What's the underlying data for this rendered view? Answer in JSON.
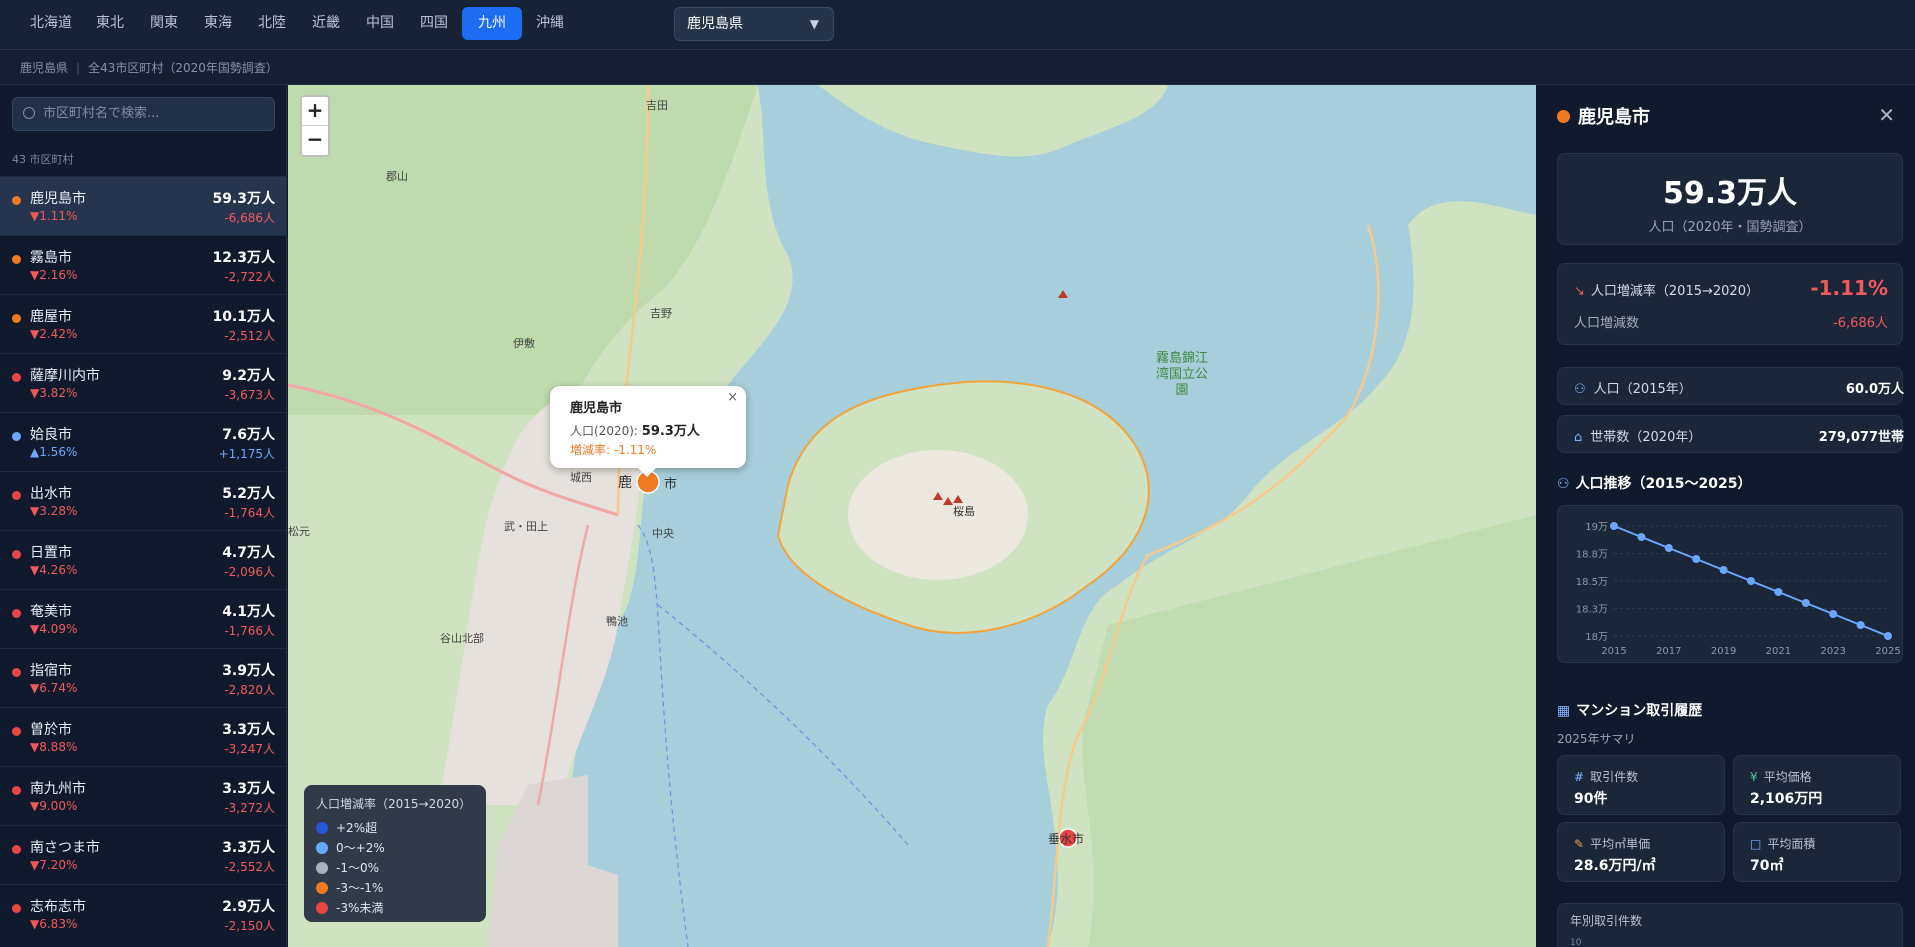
{
  "regions": [
    "北海道",
    "東北",
    "関東",
    "東海",
    "北陸",
    "近畿",
    "中国",
    "四国",
    "九州",
    "沖縄"
  ],
  "active_region": "九州",
  "prefecture_select": "鹿児島県",
  "subbar": {
    "prefecture": "鹿児島県",
    "summary": "全43市区町村（2020年国勢調査）"
  },
  "search": {
    "placeholder": "市区町村名で検索..."
  },
  "list_count": "43 市区町村",
  "municipalities": [
    {
      "name": "鹿児島市",
      "rate": "▼1.11%",
      "pop": "59.3万人",
      "diff": "-6,686人",
      "color": "#f07a24"
    },
    {
      "name": "霧島市",
      "rate": "▼2.16%",
      "pop": "12.3万人",
      "diff": "-2,722人",
      "color": "#f07a24"
    },
    {
      "name": "鹿屋市",
      "rate": "▼2.42%",
      "pop": "10.1万人",
      "diff": "-2,512人",
      "color": "#f07a24"
    },
    {
      "name": "薩摩川内市",
      "rate": "▼3.82%",
      "pop": "9.2万人",
      "diff": "-3,673人",
      "color": "#e84545"
    },
    {
      "name": "姶良市",
      "rate": "▲1.56%",
      "pop": "7.6万人",
      "diff": "+1,175人",
      "color": "#6aa7ff"
    },
    {
      "name": "出水市",
      "rate": "▼3.28%",
      "pop": "5.2万人",
      "diff": "-1,764人",
      "color": "#e84545"
    },
    {
      "name": "日置市",
      "rate": "▼4.26%",
      "pop": "4.7万人",
      "diff": "-2,096人",
      "color": "#e84545"
    },
    {
      "name": "奄美市",
      "rate": "▼4.09%",
      "pop": "4.1万人",
      "diff": "-1,766人",
      "color": "#e84545"
    },
    {
      "name": "指宿市",
      "rate": "▼6.74%",
      "pop": "3.9万人",
      "diff": "-2,820人",
      "color": "#e84545"
    },
    {
      "name": "曽於市",
      "rate": "▼8.88%",
      "pop": "3.3万人",
      "diff": "-3,247人",
      "color": "#e84545"
    },
    {
      "name": "南九州市",
      "rate": "▼9.00%",
      "pop": "3.3万人",
      "diff": "-3,272人",
      "color": "#e84545"
    },
    {
      "name": "南さつま市",
      "rate": "▼7.20%",
      "pop": "3.3万人",
      "diff": "-2,552人",
      "color": "#e84545"
    },
    {
      "name": "志布志市",
      "rate": "▼6.83%",
      "pop": "2.9万人",
      "diff": "-2,150人",
      "color": "#e84545"
    }
  ],
  "map": {
    "zoom_in": "+",
    "zoom_out": "−",
    "labels": {
      "sakurajima": "桜島",
      "park": "霧島錦江湾国立公園",
      "tarumizu": "垂水市",
      "kagoshima": "鹿",
      "shi": "市",
      "ijuin": "伊敷",
      "yoshino": "吉野",
      "chuo": "中央",
      "taniyama": "谷山北部",
      "kamoike": "鴨池",
      "shiroyama": "城西",
      "takeda": "武・田上",
      "matsumoto": "松元",
      "gunsan": "郡山",
      "kiire": "吉田"
    },
    "popup": {
      "title": "鹿児島市",
      "pop_label": "人口(2020):",
      "pop_value": "59.3万人",
      "rate": "増減率: -1.11%",
      "close": "×"
    },
    "legend": {
      "title": "人口増減率（2015→2020）",
      "items": [
        {
          "label": "+2%超",
          "color": "#2357d6"
        },
        {
          "label": "0〜+2%",
          "color": "#6aa7ff"
        },
        {
          "label": "-1〜0%",
          "color": "#a9b1bd"
        },
        {
          "label": "-3〜-1%",
          "color": "#f07a24"
        },
        {
          "label": "-3%未満",
          "color": "#e84545"
        }
      ]
    }
  },
  "panel": {
    "title": "鹿児島市",
    "close": "✕",
    "population": "59.3万人",
    "population_sub": "人口（2020年・国勢調査）",
    "rate_label": "人口増減率（2015→2020）",
    "rate_value": "-1.11%",
    "diff_label": "人口増減数",
    "diff_value": "-6,686人",
    "pop2015_label": "人口（2015年）",
    "pop2015_value": "60.0万人",
    "households_label": "世帯数（2020年）",
    "households_value": "279,077世帯",
    "trend_title": "人口推移（2015〜2025）",
    "mansion_title": "マンション取引履歴",
    "summary_label": "2025年サマリ",
    "stats": [
      {
        "label": "取引件数",
        "value": "90件",
        "icon": "#"
      },
      {
        "label": "平均価格",
        "value": "2,106万円",
        "icon": "¥"
      },
      {
        "label": "平均㎡単価",
        "value": "28.6万円/㎡",
        "icon": "✎"
      },
      {
        "label": "平均面積",
        "value": "70㎡",
        "icon": "□"
      }
    ],
    "yearly_label": "年別取引件数",
    "yearly_axis_top": "10"
  },
  "chart_data": {
    "type": "line",
    "title": "人口推移（2015〜2025）",
    "x": [
      2015,
      2016,
      2017,
      2018,
      2019,
      2020,
      2021,
      2022,
      2023,
      2024,
      2025
    ],
    "x_tick_labels": [
      "2015",
      "2017",
      "2019",
      "2021",
      "2023",
      "2025"
    ],
    "y_tick_labels": [
      "19万",
      "18.8万",
      "18.5万",
      "18.3万",
      "18万"
    ],
    "y_ticks": [
      19.0,
      18.75,
      18.5,
      18.25,
      18.0
    ],
    "ylim": [
      18.0,
      19.0
    ],
    "series": [
      {
        "values": [
          19.0,
          18.9,
          18.8,
          18.7,
          18.6,
          18.5,
          18.4,
          18.3,
          18.2,
          18.1,
          18.0
        ],
        "color": "#6aa7ff"
      }
    ],
    "grid": true
  }
}
